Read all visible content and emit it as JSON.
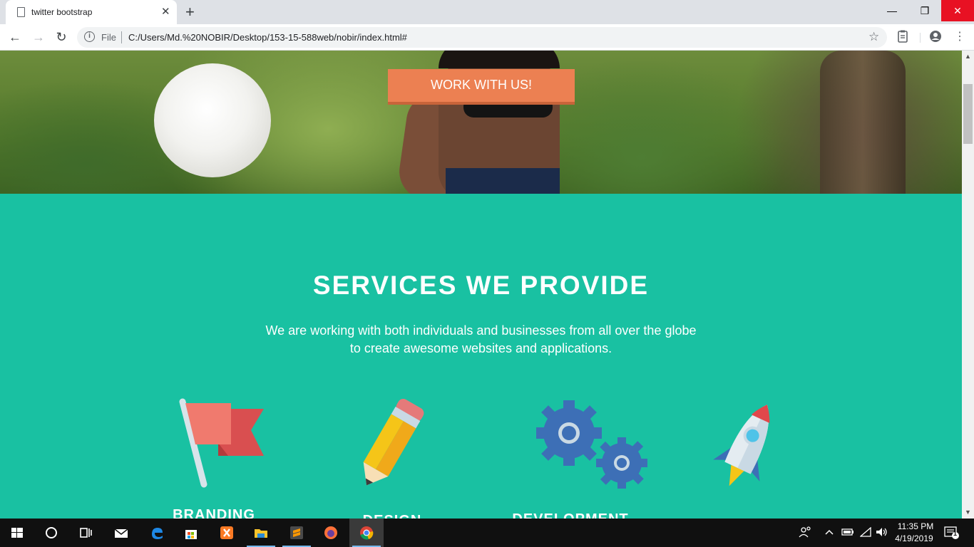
{
  "browser": {
    "tab_title": "twitter bootstrap",
    "tab_close": "✕",
    "new_tab": "+",
    "window_controls": {
      "minimize": "—",
      "maximize": "❐",
      "close": "✕"
    },
    "nav": {
      "back": "←",
      "forward": "→",
      "reload": "↻"
    },
    "address": {
      "security_label": "File",
      "url": "C:/Users/Md.%20NOBIR/Desktop/153-15-588web/nobir/index.html#"
    }
  },
  "page": {
    "hero": {
      "cta_label": "WORK WITH US!"
    },
    "services": {
      "title": "SERVICES WE PROVIDE",
      "description_line1": "We are working with both individuals and businesses from all over the globe",
      "description_line2": "to create awesome websites and applications.",
      "items": [
        {
          "label": "BRANDING",
          "icon": "flag-icon"
        },
        {
          "label": "DESIGN",
          "icon": "pencil-icon"
        },
        {
          "label": "DEVELOPMENT",
          "icon": "gears-icon"
        },
        {
          "label": "",
          "icon": "rocket-icon"
        }
      ]
    },
    "colors": {
      "accent": "#19c1a2",
      "cta": "#ec8052"
    }
  },
  "taskbar": {
    "apps": [
      "start-icon",
      "cortana-icon",
      "task-view-icon",
      "mail-icon",
      "edge-icon",
      "store-icon",
      "xampp-icon",
      "file-explorer-icon",
      "sublime-text-icon",
      "firefox-icon",
      "chrome-icon"
    ],
    "clock_time": "11:35 PM",
    "clock_date": "4/19/2019",
    "notification_count": "1"
  }
}
